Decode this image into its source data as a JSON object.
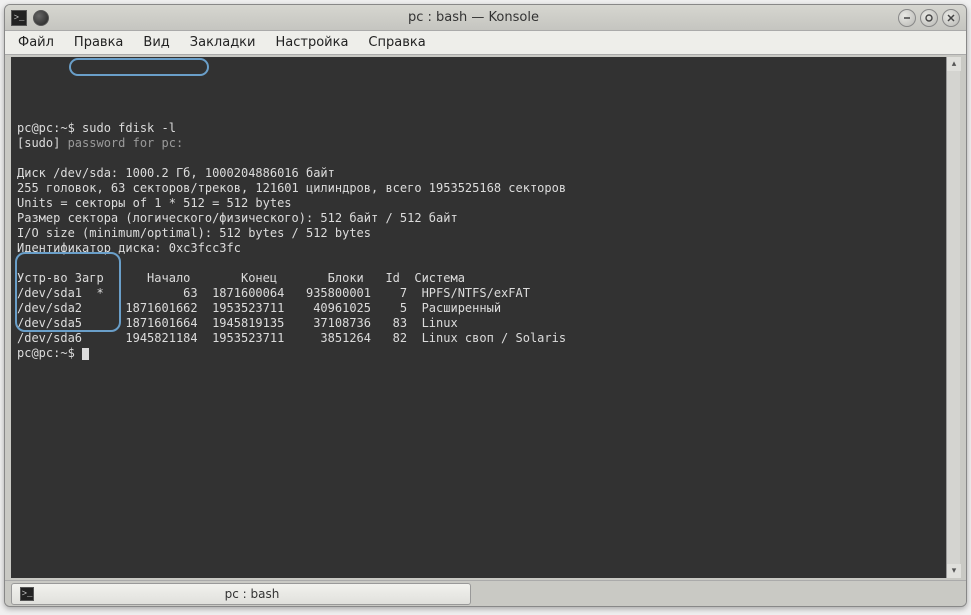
{
  "window": {
    "title": "pc : bash — Konsole"
  },
  "menu": {
    "items": [
      "Файл",
      "Правка",
      "Вид",
      "Закладки",
      "Настройка",
      "Справка"
    ]
  },
  "prompt1": {
    "user": "pc@pc",
    "sep": ":~",
    "sym": "$ ",
    "cmd": "sudo fdisk -l"
  },
  "sudo_line": {
    "prefix": "[sudo] ",
    "rest": "password for pc:"
  },
  "disk_info": {
    "l1": "Диск /dev/sda: 1000.2 Гб, 1000204886016 байт",
    "l2": "255 головок, 63 секторов/треков, 121601 цилиндров, всего 1953525168 секторов",
    "l3": "Units = секторы of 1 * 512 = 512 bytes",
    "l4": "Размер сектора (логического/физического): 512 байт / 512 байт",
    "l5": "I/O size (minimum/optimal): 512 bytes / 512 bytes",
    "l6": "Идентификатор диска: 0xc3fcc3fc"
  },
  "table": {
    "header": {
      "dev": "Устр-во",
      "boot": "Загр",
      "start": "Начало",
      "end": "Конец",
      "blocks": "Блоки",
      "id": "Id",
      "system": "Система"
    },
    "rows": [
      {
        "dev": "/dev/sda1",
        "boot": "*",
        "start": "63",
        "end": "1871600064",
        "blocks": "935800001",
        "id": "7",
        "system": "HPFS/NTFS/exFAT"
      },
      {
        "dev": "/dev/sda2",
        "boot": "",
        "start": "1871601662",
        "end": "1953523711",
        "blocks": "40961025",
        "id": "5",
        "system": "Расширенный"
      },
      {
        "dev": "/dev/sda5",
        "boot": "",
        "start": "1871601664",
        "end": "1945819135",
        "blocks": "37108736",
        "id": "83",
        "system": "Linux"
      },
      {
        "dev": "/dev/sda6",
        "boot": "",
        "start": "1945821184",
        "end": "1953523711",
        "blocks": "3851264",
        "id": "82",
        "system": "Linux своп / Solaris"
      }
    ]
  },
  "prompt2": {
    "user": "pc@pc",
    "sep": ":~",
    "sym": "$ "
  },
  "tab": {
    "label": "pc : bash"
  }
}
